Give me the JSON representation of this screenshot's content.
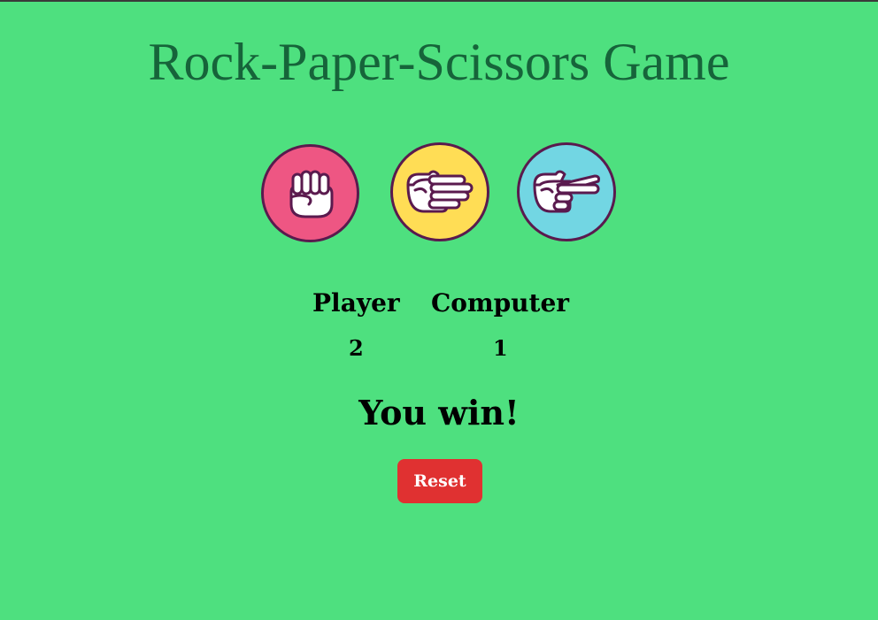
{
  "title": "Rock-Paper-Scissors Game",
  "choices": [
    {
      "name": "rock",
      "icon": "fist-icon",
      "color": "#ee5683"
    },
    {
      "name": "paper",
      "icon": "open-hand-icon",
      "color": "#ffdd55"
    },
    {
      "name": "scissors",
      "icon": "two-finger-hand-icon",
      "color": "#72d6e3"
    }
  ],
  "scoreboard": {
    "player_label": "Player",
    "computer_label": "Computer",
    "player_score": "2",
    "computer_score": "1"
  },
  "result": "You win!",
  "reset_label": "Reset",
  "colors": {
    "background": "#4ee07f",
    "title": "#16643a",
    "outline": "#5a1a4e",
    "reset": "#e03131"
  }
}
